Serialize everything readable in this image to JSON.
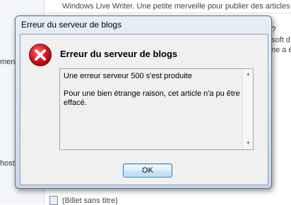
{
  "background": {
    "top_line": "Windows Live Writer. Une petite merveille pour publier des articles",
    "right_fragments": [
      "?",
      "soft d",
      "ne a é"
    ],
    "left_fragments": [
      "men",
      "host"
    ],
    "bottom_item": "(Billet sans titre)"
  },
  "dialog": {
    "title": "Erreur du serveur de blogs",
    "heading": "Erreur du serveur de blogs",
    "message_line1": "Une erreur serveur 500 s'est produite",
    "message_line2": "Pour une bien étrange raison, cet article n'a pu être effacé.",
    "ok_label": "OK",
    "icon": "error-icon",
    "accent_color": "#c8111b"
  }
}
